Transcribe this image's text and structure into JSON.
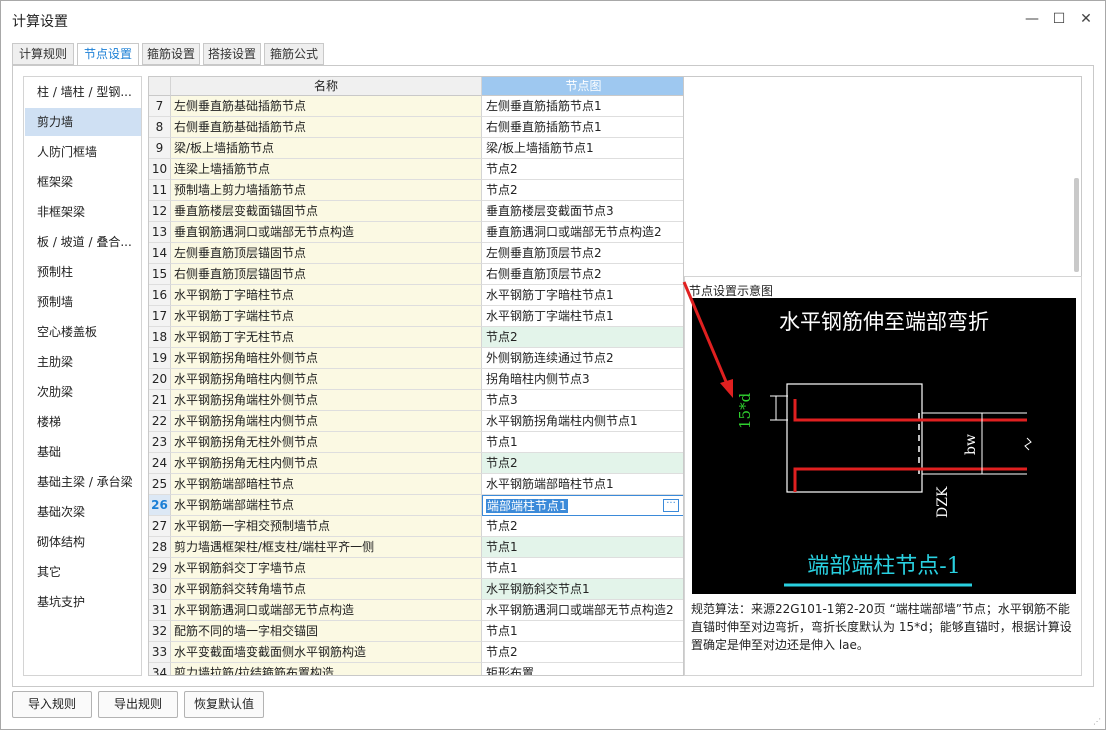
{
  "window": {
    "title": "计算设置",
    "minimize_glyph": "—",
    "maximize_glyph": "☐",
    "close_glyph": "✕"
  },
  "tabs": [
    {
      "label": "计算规则",
      "active": false
    },
    {
      "label": "节点设置",
      "active": true
    },
    {
      "label": "箍筋设置",
      "active": false
    },
    {
      "label": "搭接设置",
      "active": false
    },
    {
      "label": "箍筋公式",
      "active": false
    }
  ],
  "sidebar": {
    "items": [
      {
        "label": "柱 / 墙柱 / 型钢...",
        "selected": false
      },
      {
        "label": "剪力墙",
        "selected": true
      },
      {
        "label": "人防门框墙",
        "selected": false
      },
      {
        "label": "框架梁",
        "selected": false
      },
      {
        "label": "非框架梁",
        "selected": false
      },
      {
        "label": "板 / 坡道 / 叠合...",
        "selected": false
      },
      {
        "label": "预制柱",
        "selected": false
      },
      {
        "label": "预制墙",
        "selected": false
      },
      {
        "label": "空心楼盖板",
        "selected": false
      },
      {
        "label": "主肋梁",
        "selected": false
      },
      {
        "label": "次肋梁",
        "selected": false
      },
      {
        "label": "楼梯",
        "selected": false
      },
      {
        "label": "基础",
        "selected": false
      },
      {
        "label": "基础主梁 / 承台梁",
        "selected": false
      },
      {
        "label": "基础次梁",
        "selected": false
      },
      {
        "label": "砌体结构",
        "selected": false
      },
      {
        "label": "其它",
        "selected": false
      },
      {
        "label": "基坑支护",
        "selected": false
      }
    ]
  },
  "grid": {
    "columns": {
      "name": "名称",
      "node": "节点图"
    },
    "rows": [
      {
        "num": "7",
        "name": "左侧垂直筋基础插筋节点",
        "node": "左侧垂直筋插筋节点1",
        "green": false
      },
      {
        "num": "8",
        "name": "右侧垂直筋基础插筋节点",
        "node": "右侧垂直筋插筋节点1",
        "green": false
      },
      {
        "num": "9",
        "name": "梁/板上墙插筋节点",
        "node": "梁/板上墙插筋节点1",
        "green": false
      },
      {
        "num": "10",
        "name": "连梁上墙插筋节点",
        "node": "节点2",
        "green": false
      },
      {
        "num": "11",
        "name": "预制墙上剪力墙插筋节点",
        "node": "节点2",
        "green": false
      },
      {
        "num": "12",
        "name": "垂直筋楼层变截面锚固节点",
        "node": "垂直筋楼层变截面节点3",
        "green": false
      },
      {
        "num": "13",
        "name": "垂直钢筋遇洞口或端部无节点构造",
        "node": "垂直筋遇洞口或端部无节点构造2",
        "green": false
      },
      {
        "num": "14",
        "name": "左侧垂直筋顶层锚固节点",
        "node": "左侧垂直筋顶层节点2",
        "green": false
      },
      {
        "num": "15",
        "name": "右侧垂直筋顶层锚固节点",
        "node": "右侧垂直筋顶层节点2",
        "green": false
      },
      {
        "num": "16",
        "name": "水平钢筋丁字暗柱节点",
        "node": "水平钢筋丁字暗柱节点1",
        "green": false
      },
      {
        "num": "17",
        "name": "水平钢筋丁字端柱节点",
        "node": "水平钢筋丁字端柱节点1",
        "green": false
      },
      {
        "num": "18",
        "name": "水平钢筋丁字无柱节点",
        "node": "节点2",
        "green": true
      },
      {
        "num": "19",
        "name": "水平钢筋拐角暗柱外侧节点",
        "node": "外侧钢筋连续通过节点2",
        "green": false
      },
      {
        "num": "20",
        "name": "水平钢筋拐角暗柱内侧节点",
        "node": "拐角暗柱内侧节点3",
        "green": false
      },
      {
        "num": "21",
        "name": "水平钢筋拐角端柱外侧节点",
        "node": "节点3",
        "green": false
      },
      {
        "num": "22",
        "name": "水平钢筋拐角端柱内侧节点",
        "node": "水平钢筋拐角端柱内侧节点1",
        "green": false
      },
      {
        "num": "23",
        "name": "水平钢筋拐角无柱外侧节点",
        "node": "节点1",
        "green": false
      },
      {
        "num": "24",
        "name": "水平钢筋拐角无柱内侧节点",
        "node": "节点2",
        "green": true
      },
      {
        "num": "25",
        "name": "水平钢筋端部暗柱节点",
        "node": "水平钢筋端部暗柱节点1",
        "green": false
      },
      {
        "num": "26",
        "name": "水平钢筋端部端柱节点",
        "node": "端部端柱节点1",
        "green": false,
        "current": true
      },
      {
        "num": "27",
        "name": "水平钢筋一字相交预制墙节点",
        "node": "节点2",
        "green": false
      },
      {
        "num": "28",
        "name": "剪力墙遇框架柱/框支柱/端柱平齐一侧",
        "node": "节点1",
        "green": true
      },
      {
        "num": "29",
        "name": "水平钢筋斜交丁字墙节点",
        "node": "节点1",
        "green": false
      },
      {
        "num": "30",
        "name": "水平钢筋斜交转角墙节点",
        "node": "水平钢筋斜交节点1",
        "green": true
      },
      {
        "num": "31",
        "name": "水平钢筋遇洞口或端部无节点构造",
        "node": "水平钢筋遇洞口或端部无节点构造2",
        "green": false
      },
      {
        "num": "32",
        "name": "配筋不同的墙一字相交锚固",
        "node": "节点1",
        "green": false
      },
      {
        "num": "33",
        "name": "水平变截面墙变截面侧水平钢筋构造",
        "node": "节点2",
        "green": false
      },
      {
        "num": "34",
        "name": "剪力墙拉筋/拉结箍筋布置构造",
        "node": "矩形布置",
        "green": false
      }
    ]
  },
  "diagram": {
    "panel_title": "节点设置示意图",
    "heading": "水平钢筋伸至端部弯折",
    "dim_label": "15*d",
    "bw_label": "bw",
    "dzk_label": "DZK",
    "caption": "端部端柱节点-1",
    "description": "规范算法：来源22G101-1第2-20页 “端柱端部墙”节点；水平钢筋不能直锚时伸至对边弯折，弯折长度默认为 15*d；能够直锚时，根据计算设置确定是伸至对边还是伸入 lae。",
    "colors": {
      "rebar": "#e02020",
      "text": "#ffffff",
      "dim": "#2fd12f",
      "caption": "#29d0e0",
      "arrow": "#e02020"
    }
  },
  "buttons": {
    "import": "导入规则",
    "export": "导出规则",
    "restore": "恢复默认值"
  }
}
